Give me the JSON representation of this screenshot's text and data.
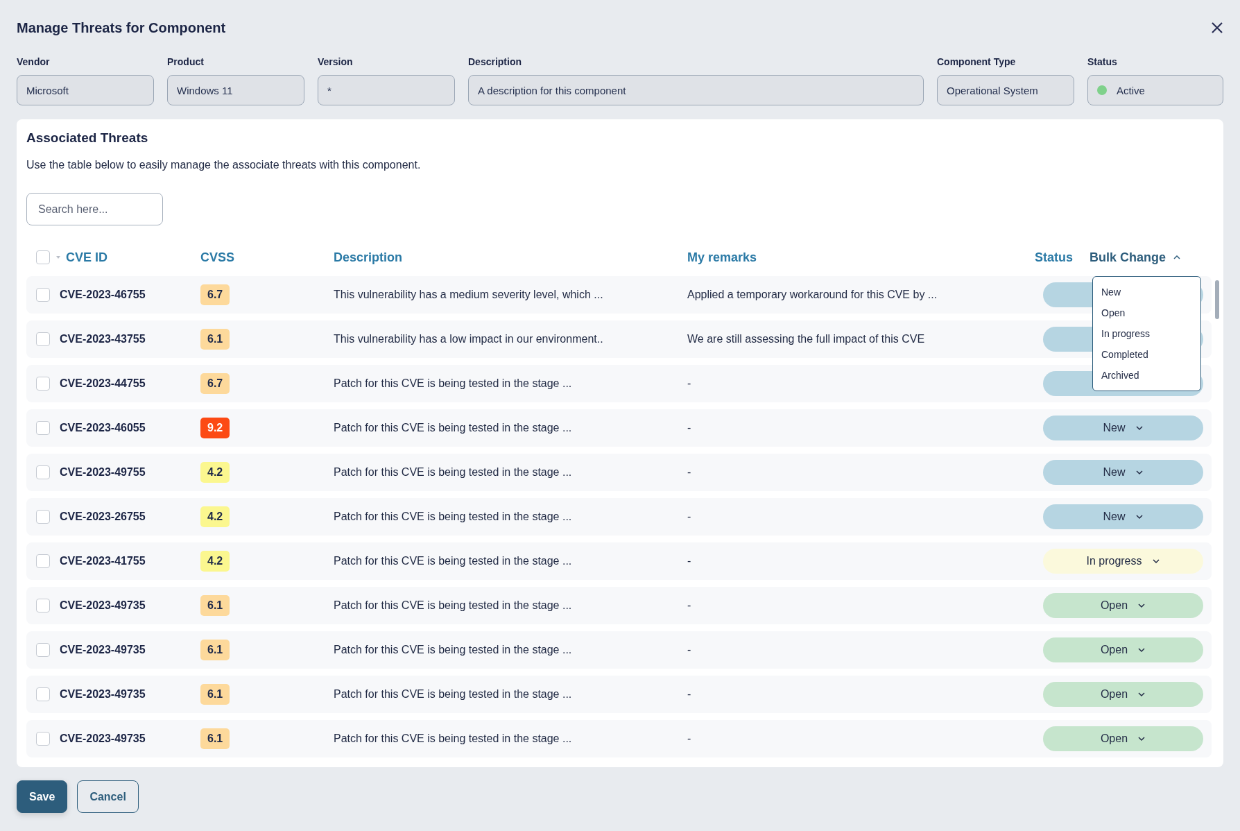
{
  "dialog": {
    "title": "Manage Threats for Component"
  },
  "fields": [
    {
      "label": "Vendor",
      "value": "Microsoft"
    },
    {
      "label": "Product",
      "value": "Windows 11"
    },
    {
      "label": "Version",
      "value": "*"
    },
    {
      "label": "Description",
      "value": "A description for this component"
    },
    {
      "label": "Component Type",
      "value": "Operational System"
    },
    {
      "label": "Status",
      "value": "Active",
      "kind": "status",
      "color": "#7fd18b"
    }
  ],
  "threats": {
    "title": "Associated Threats",
    "subtitle": "Use the table below to easily manage the associate threats with this component.",
    "search": {
      "placeholder": "Search here..."
    },
    "select_all": {
      "checked": false
    },
    "columns": [
      "CVE ID",
      "CVSS",
      "Description",
      "My remarks",
      "Status"
    ],
    "bulk_change": {
      "label": "Bulk Change",
      "expanded": true,
      "options": [
        "New",
        "Open",
        "In progress",
        "Completed",
        "Archived"
      ]
    },
    "rows": [
      {
        "checked": false,
        "cve": "CVE-2023-46755",
        "cvss": "6.7",
        "color": "#fdd99b",
        "description": "This vulnerability has a medium severity level, which ...",
        "remarks": "Applied a temporary workaround for this CVE by ...",
        "status": {
          "kind": "new"
        }
      },
      {
        "checked": false,
        "cve": "CVE-2023-43755",
        "cvss": "6.1",
        "color": "#fdd99b",
        "description": "This vulnerability has a low impact in our environment..",
        "remarks": "We are still assessing the full impact of this CVE",
        "status": {
          "kind": "new"
        }
      },
      {
        "checked": false,
        "cve": "CVE-2023-44755",
        "cvss": "6.7",
        "color": "#fdd99b",
        "description": "Patch for this CVE is being tested in the stage ...",
        "remarks": "-",
        "status": {
          "kind": "new"
        }
      },
      {
        "checked": false,
        "cve": "CVE-2023-46055",
        "cvss": "9.2",
        "color": "#fc4a14",
        "description": "Patch for this CVE is being tested in the stage ...",
        "remarks": "-",
        "status": {
          "kind": "new",
          "label": "New"
        }
      },
      {
        "checked": false,
        "cve": "CVE-2023-49755",
        "cvss": "4.2",
        "color": "#fbf78f",
        "description": "Patch for this CVE is being tested in the stage ...",
        "remarks": "-",
        "status": {
          "kind": "new",
          "label": "New"
        }
      },
      {
        "checked": false,
        "cve": "CVE-2023-26755",
        "cvss": "4.2",
        "color": "#fbf78f",
        "description": "Patch for this CVE is being tested in the stage ...",
        "remarks": "-",
        "status": {
          "kind": "new",
          "label": "New"
        }
      },
      {
        "checked": false,
        "cve": "CVE-2023-41755",
        "cvss": "4.2",
        "color": "#fbf78f",
        "description": "Patch for this CVE is being tested in the stage ...",
        "remarks": "-",
        "status": {
          "kind": "in_progress",
          "label": "In progress"
        }
      },
      {
        "checked": false,
        "cve": "CVE-2023-49735",
        "cvss": "6.1",
        "color": "#fdd99b",
        "description": "Patch for this CVE is being tested in the stage ...",
        "remarks": "-",
        "status": {
          "kind": "open",
          "label": "Open"
        }
      },
      {
        "checked": false,
        "cve": "CVE-2023-49735",
        "cvss": "6.1",
        "color": "#fdd99b",
        "description": "Patch for this CVE is being tested in the stage ...",
        "remarks": "-",
        "status": {
          "kind": "open",
          "label": "Open"
        }
      },
      {
        "checked": false,
        "cve": "CVE-2023-49735",
        "cvss": "6.1",
        "color": "#fdd99b",
        "description": "Patch for this CVE is being tested in the stage ...",
        "remarks": "-",
        "status": {
          "kind": "open",
          "label": "Open"
        }
      },
      {
        "checked": false,
        "cve": "CVE-2023-49735",
        "cvss": "6.1",
        "color": "#fdd99b",
        "description": "Patch for this CVE is being tested in the stage ...",
        "remarks": "-",
        "status": {
          "kind": "open",
          "label": "Open"
        }
      }
    ]
  },
  "buttons": [
    {
      "label": "Save",
      "kind": "primary"
    },
    {
      "label": "Cancel",
      "kind": "secondary"
    }
  ]
}
